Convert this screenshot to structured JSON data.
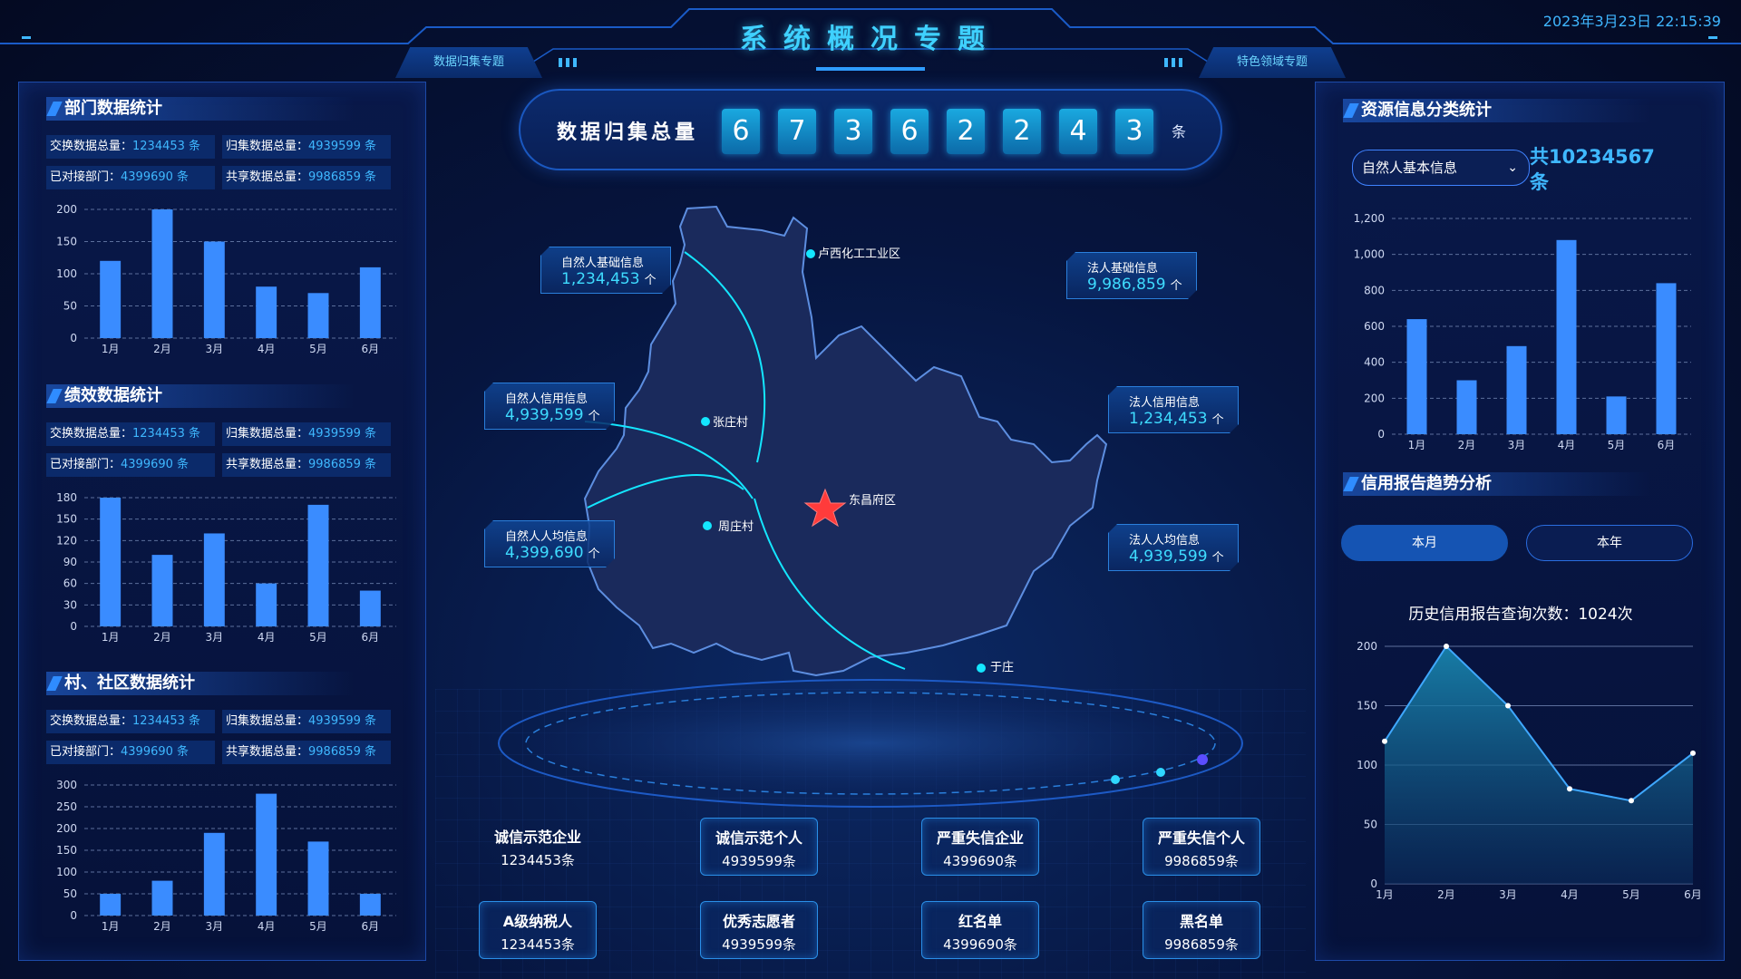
{
  "header": {
    "title": "系统概况专题",
    "datetime": "2023年3月23日 22:15:39",
    "tab_left": "数据归集专题",
    "tab_right": "特色领域专题"
  },
  "left": {
    "dept": {
      "title": "部门数据统计",
      "stats": [
        {
          "k": "交换数据总量：",
          "v": "1234453 条"
        },
        {
          "k": "归集数据总量：",
          "v": "4939599 条"
        },
        {
          "k": "已对接部门：",
          "v": "4399690 条"
        },
        {
          "k": "共享数据总量：",
          "v": "9986859 条"
        }
      ]
    },
    "perf": {
      "title": "绩效数据统计",
      "stats": [
        {
          "k": "交换数据总量：",
          "v": "1234453 条"
        },
        {
          "k": "归集数据总量：",
          "v": "4939599 条"
        },
        {
          "k": "已对接部门：",
          "v": "4399690 条"
        },
        {
          "k": "共享数据总量：",
          "v": "9986859 条"
        }
      ]
    },
    "village": {
      "title": "村、社区数据统计",
      "stats": [
        {
          "k": "交换数据总量：",
          "v": "1234453 条"
        },
        {
          "k": "归集数据总量：",
          "v": "4939599 条"
        },
        {
          "k": "已对接部门：",
          "v": "4399690 条"
        },
        {
          "k": "共享数据总量：",
          "v": "9986859 条"
        }
      ]
    }
  },
  "center": {
    "total_label": "数据归集总量",
    "digits": [
      "6",
      "7",
      "3",
      "6",
      "2",
      "2",
      "4",
      "3"
    ],
    "unit": "条",
    "cards": [
      {
        "k": "自然人基础信息",
        "v": "1,234,453",
        "a": "个"
      },
      {
        "k": "法人基础信息",
        "v": "9,986,859",
        "a": "个"
      },
      {
        "k": "自然人信用信息",
        "v": "4,939,599",
        "a": "个"
      },
      {
        "k": "法人信用信息",
        "v": "1,234,453",
        "a": "个"
      },
      {
        "k": "自然人人均信息",
        "v": "4,399,690",
        "a": "个"
      },
      {
        "k": "法人人均信息",
        "v": "4,939,599",
        "a": "个"
      }
    ],
    "places": {
      "center": "东昌府区",
      "p1": "卢西化工工业区",
      "p2": "张庄村",
      "p3": "周庄村",
      "p4": "于庄"
    },
    "stats": [
      {
        "t": "诚信示范企业",
        "n": "1234453条"
      },
      {
        "t": "诚信示范个人",
        "n": "4939599条"
      },
      {
        "t": "严重失信企业",
        "n": "4399690条"
      },
      {
        "t": "严重失信个人",
        "n": "9986859条"
      },
      {
        "t": "A级纳税人",
        "n": "1234453条"
      },
      {
        "t": "优秀志愿者",
        "n": "4939599条"
      },
      {
        "t": "红名单",
        "n": "4399690条"
      },
      {
        "t": "黑名单",
        "n": "9986859条"
      }
    ]
  },
  "right": {
    "resource_title": "资源信息分类统计",
    "select_value": "自然人基本信息",
    "total_count": "共10234567条",
    "credit_title": "信用报告趋势分析",
    "tab_month": "本月",
    "tab_year": "本年",
    "hist_title": "历史信用报告查询次数：1024次"
  },
  "chart_data": [
    {
      "type": "bar",
      "categories": [
        "1月",
        "2月",
        "3月",
        "4月",
        "5月",
        "6月"
      ],
      "values": [
        120,
        200,
        150,
        80,
        70,
        110
      ],
      "yticks": [
        0,
        50,
        100,
        150,
        200
      ],
      "ylim": [
        0,
        200
      ]
    },
    {
      "type": "bar",
      "categories": [
        "1月",
        "2月",
        "3月",
        "4月",
        "5月",
        "6月"
      ],
      "values": [
        180,
        100,
        130,
        60,
        170,
        50
      ],
      "yticks": [
        0,
        30,
        60,
        90,
        120,
        150,
        180
      ],
      "ylim": [
        0,
        180
      ]
    },
    {
      "type": "bar",
      "categories": [
        "1月",
        "2月",
        "3月",
        "4月",
        "5月",
        "6月"
      ],
      "values": [
        50,
        80,
        190,
        280,
        170,
        50
      ],
      "yticks": [
        0,
        50,
        100,
        150,
        200,
        250,
        300
      ],
      "ylim": [
        0,
        300
      ]
    },
    {
      "type": "bar",
      "categories": [
        "1月",
        "2月",
        "3月",
        "4月",
        "5月",
        "6月"
      ],
      "values": [
        640,
        300,
        490,
        1080,
        210,
        840
      ],
      "yticks": [
        "0",
        "200",
        "400",
        "600",
        "800",
        "1,000",
        "1,200"
      ],
      "ylim": [
        0,
        1200
      ]
    },
    {
      "type": "area",
      "categories": [
        "1月",
        "2月",
        "3月",
        "4月",
        "5月",
        "6月"
      ],
      "values": [
        120,
        200,
        150,
        80,
        70,
        110
      ],
      "yticks": [
        0,
        50,
        100,
        150,
        200
      ],
      "ylim": [
        0,
        200
      ]
    }
  ],
  "colors": {
    "accent": "#3fd1ff",
    "bar": "#3a8cff",
    "panel": "#0b2a6a"
  }
}
